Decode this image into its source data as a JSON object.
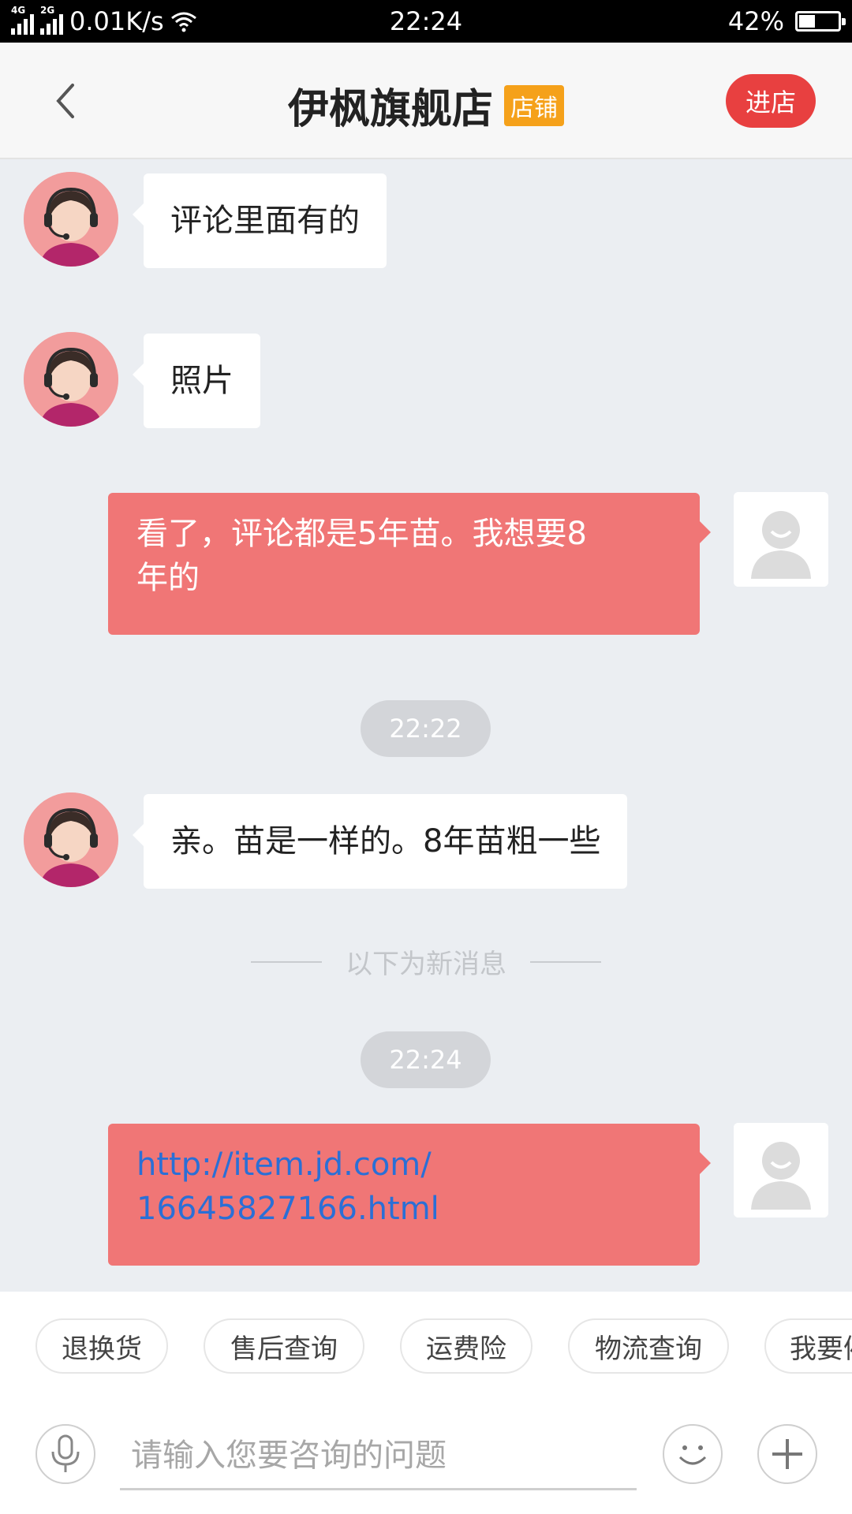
{
  "status_bar": {
    "net1": "4G",
    "net2": "2G",
    "speed": "0.01K/s",
    "time": "22:24",
    "battery_text": "42%",
    "battery_level": 0.42
  },
  "header": {
    "title": "伊枫旗舰店",
    "tag": "店铺",
    "enter_label": "进店"
  },
  "messages": [
    {
      "side": "left",
      "text": "评论里面有的"
    },
    {
      "side": "left",
      "text": "照片"
    },
    {
      "side": "right",
      "line1": "看了，评论都是5年苗。我想要8",
      "line2": "年的"
    },
    {
      "time": "22:22"
    },
    {
      "side": "left",
      "text": "亲。苗是一样的。8年苗粗一些"
    },
    {
      "divider": "以下为新消息"
    },
    {
      "time": "22:24"
    },
    {
      "side": "right",
      "line1": "http://item.jd.com/",
      "line2": "16645827166.html"
    }
  ],
  "quick_replies": [
    "退换货",
    "售后查询",
    "运费险",
    "物流查询",
    "我要催"
  ],
  "input": {
    "placeholder": "请输入您要咨询的问题"
  },
  "colors": {
    "accent": "#e84040",
    "bubble_right": "#f07676",
    "tag": "#f5a11a",
    "link": "#2a6fd6"
  }
}
